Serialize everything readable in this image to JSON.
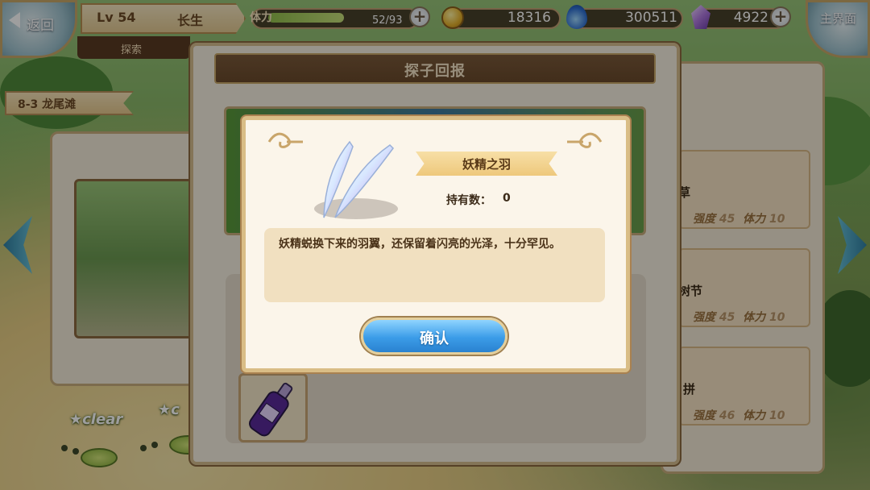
{
  "top_bar": {
    "back_label": "返回",
    "level": "Lv 54",
    "player_name": "长生",
    "explore_tab": "探索",
    "stamina_label": "体力",
    "stamina_value": "52/93",
    "stamina_fraction": 0.56,
    "gold": "18316",
    "gems": "300511",
    "crystals": "4922",
    "home_label": "主界面"
  },
  "stage": {
    "label": "8-3  龙尾滩"
  },
  "map": {
    "clear_1": "clear",
    "clear_2": "c"
  },
  "scout_report": {
    "title": "探子回报"
  },
  "right_list": [
    {
      "name": "草",
      "stat1_label": "强度",
      "stat1_value": "45",
      "stat2_label": "体力",
      "stat2_value": "10"
    },
    {
      "name": "树节",
      "stat1_label": "强度",
      "stat1_value": "45",
      "stat2_label": "体力",
      "stat2_value": "10"
    },
    {
      "name": "拼",
      "stat1_label": "强度",
      "stat1_value": "46",
      "stat2_label": "体力",
      "stat2_value": "10"
    }
  ],
  "item_dialog": {
    "name": "妖精之羽",
    "owned_label": "持有数：",
    "owned_count": "0",
    "description": "妖精蜕换下来的羽翼，还保留着闪亮的光泽，十分罕见。",
    "confirm_label": "确认"
  },
  "colors": {
    "panel_bg": "#fbf5ea",
    "panel_border": "#d9bd86",
    "header_brown": "#6a4a2c",
    "confirm_blue": "#3b9ce8"
  }
}
